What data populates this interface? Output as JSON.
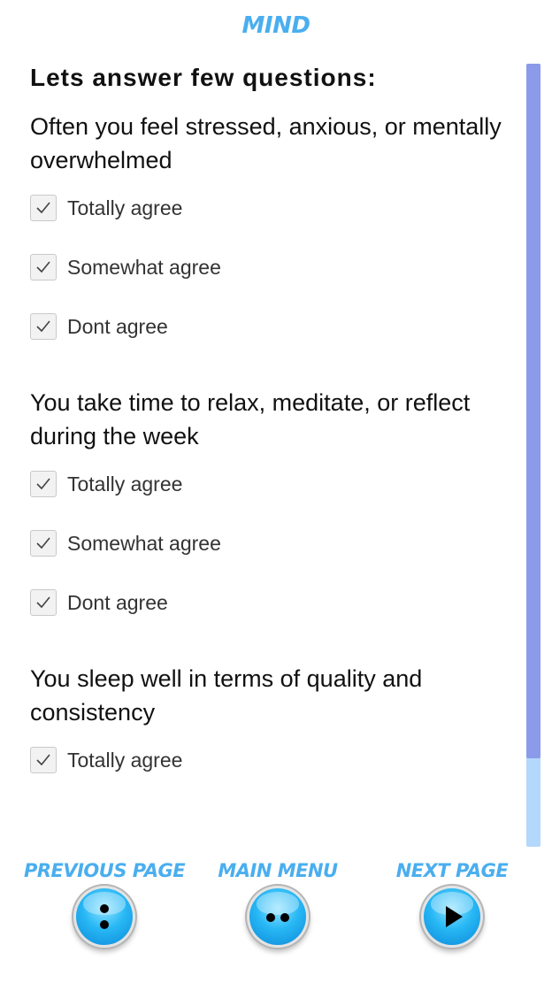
{
  "app": {
    "title": "MIND"
  },
  "survey": {
    "prompt": "Lets answer few questions:",
    "questions": [
      {
        "text": "Often you feel stressed, anxious, or mentally overwhelmed",
        "options": [
          {
            "label": "Totally agree",
            "checked": true
          },
          {
            "label": "Somewhat agree",
            "checked": true
          },
          {
            "label": "Dont agree",
            "checked": true
          }
        ]
      },
      {
        "text": "You take time to relax, meditate, or reflect during the week",
        "options": [
          {
            "label": "Totally agree",
            "checked": true
          },
          {
            "label": "Somewhat agree",
            "checked": true
          },
          {
            "label": "Dont agree",
            "checked": true
          }
        ]
      },
      {
        "text": "You sleep well in terms of quality and consistency",
        "options": [
          {
            "label": "Totally agree",
            "checked": true
          }
        ]
      }
    ]
  },
  "nav": {
    "previous": {
      "label": "PREVIOUS PAGE",
      "icon": "vertical-dots-icon"
    },
    "main_menu": {
      "label": "MAIN MENU",
      "icon": "horizontal-dots-icon"
    },
    "next": {
      "label": "NEXT PAGE",
      "icon": "play-icon"
    }
  },
  "colors": {
    "accent": "#4aaeef",
    "scroll_thumb": "#8b9be9",
    "scroll_track": "#b3d8fb",
    "button": "#1aa6ee"
  }
}
